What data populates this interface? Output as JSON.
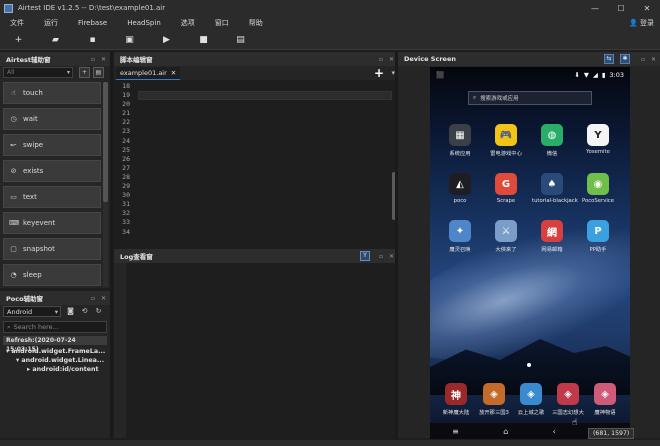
{
  "window": {
    "title": "Airtest IDE v1.2.5 -- D:\\test\\example01.air",
    "controls": [
      "—",
      "☐",
      "✕"
    ]
  },
  "menu": {
    "items": [
      "文件",
      "运行",
      "Firebase",
      "HeadSpin",
      "选项",
      "窗口",
      "帮助"
    ],
    "login": "登录"
  },
  "toolbar": {
    "buttons": [
      {
        "name": "new-button",
        "glyph": "+"
      },
      {
        "name": "open-button",
        "glyph": "▰"
      },
      {
        "name": "save-button",
        "glyph": "▪"
      },
      {
        "name": "record-button",
        "glyph": "▣"
      },
      {
        "name": "run-button",
        "glyph": "▶"
      },
      {
        "name": "stop-button",
        "glyph": "■"
      },
      {
        "name": "report-button",
        "glyph": "▤"
      }
    ]
  },
  "airtest": {
    "title": "Airtest辅助窗",
    "filter": "All",
    "items": [
      {
        "label": "touch",
        "icon": "hand-icon",
        "glyph": "☝"
      },
      {
        "label": "wait",
        "icon": "clock-icon",
        "glyph": "◷"
      },
      {
        "label": "swipe",
        "icon": "swipe-icon",
        "glyph": "↜"
      },
      {
        "label": "exists",
        "icon": "check-circle-icon",
        "glyph": "⊘"
      },
      {
        "label": "text",
        "icon": "text-icon",
        "glyph": "▭"
      },
      {
        "label": "keyevent",
        "icon": "keyboard-icon",
        "glyph": "⌨"
      },
      {
        "label": "snapshot",
        "icon": "camera-icon",
        "glyph": "▢"
      },
      {
        "label": "sleep",
        "icon": "sleep-icon",
        "glyph": "◔"
      }
    ]
  },
  "poco": {
    "title": "Poco辅助窗",
    "mode": "Android",
    "search_placeholder": "Search here...",
    "refresh": "Refresh:(2020-07-24 15:03:15)",
    "tree": [
      {
        "label": "▾ android.widget.FrameLa...",
        "indent": 0
      },
      {
        "label": "▾ android.widget.Linea...",
        "indent": 1
      },
      {
        "label": "▸ android:id/content",
        "indent": 2
      }
    ]
  },
  "editor": {
    "title": "脚本编辑窗",
    "tab": "example01.air",
    "line_numbers": [
      "18",
      "19",
      "20",
      "21",
      "22",
      "23",
      "24",
      "25",
      "26",
      "27",
      "28",
      "29",
      "30",
      "31",
      "32",
      "33",
      "34",
      "35"
    ]
  },
  "log": {
    "title": "Log查看窗"
  },
  "device": {
    "title": "Device Screen",
    "time": "3:03",
    "search_placeholder": "搜索游戏或应用",
    "apps": [
      {
        "label": "系统应用",
        "color": "#3b3f48",
        "glyph": "▦"
      },
      {
        "label": "雷电游戏中心",
        "color": "#f2c418",
        "glyph": "🎮"
      },
      {
        "label": "微信",
        "color": "#2aae67",
        "glyph": "◍"
      },
      {
        "label": "Yosemite",
        "color": "#f4f4f4",
        "glyph": "Y"
      },
      {
        "label": "poco",
        "color": "#1e1e22",
        "glyph": "◭"
      },
      {
        "label": "Scrape",
        "color": "#e04a3a",
        "glyph": "G"
      },
      {
        "label": "tutorial-blackjack",
        "color": "#2a4a7a",
        "glyph": "♠"
      },
      {
        "label": "PocoService",
        "color": "#6fbf4a",
        "glyph": "◉"
      },
      {
        "label": "魔灵召唤",
        "color": "#4f86c9",
        "glyph": "✦"
      },
      {
        "label": "大俠來了",
        "color": "#7a9ec7",
        "glyph": "⚔"
      },
      {
        "label": "网易邮箱",
        "color": "#d84040",
        "glyph": "網"
      },
      {
        "label": "PP助手",
        "color": "#3aa0e0",
        "glyph": "P"
      }
    ],
    "dock": [
      {
        "label": "新神魔大陆",
        "color": "#9a2a2a",
        "glyph": "神"
      },
      {
        "label": "放开那三国3",
        "color": "#c46a2a",
        "glyph": "◈"
      },
      {
        "label": "云上城之歌",
        "color": "#3a8ad0",
        "glyph": "◈"
      },
      {
        "label": "三国志幻想大",
        "color": "#c03a4a",
        "glyph": "◈"
      },
      {
        "label": "魔神物语",
        "color": "#d05a7a",
        "glyph": "◈"
      }
    ],
    "coords": "(681, 1597)"
  }
}
